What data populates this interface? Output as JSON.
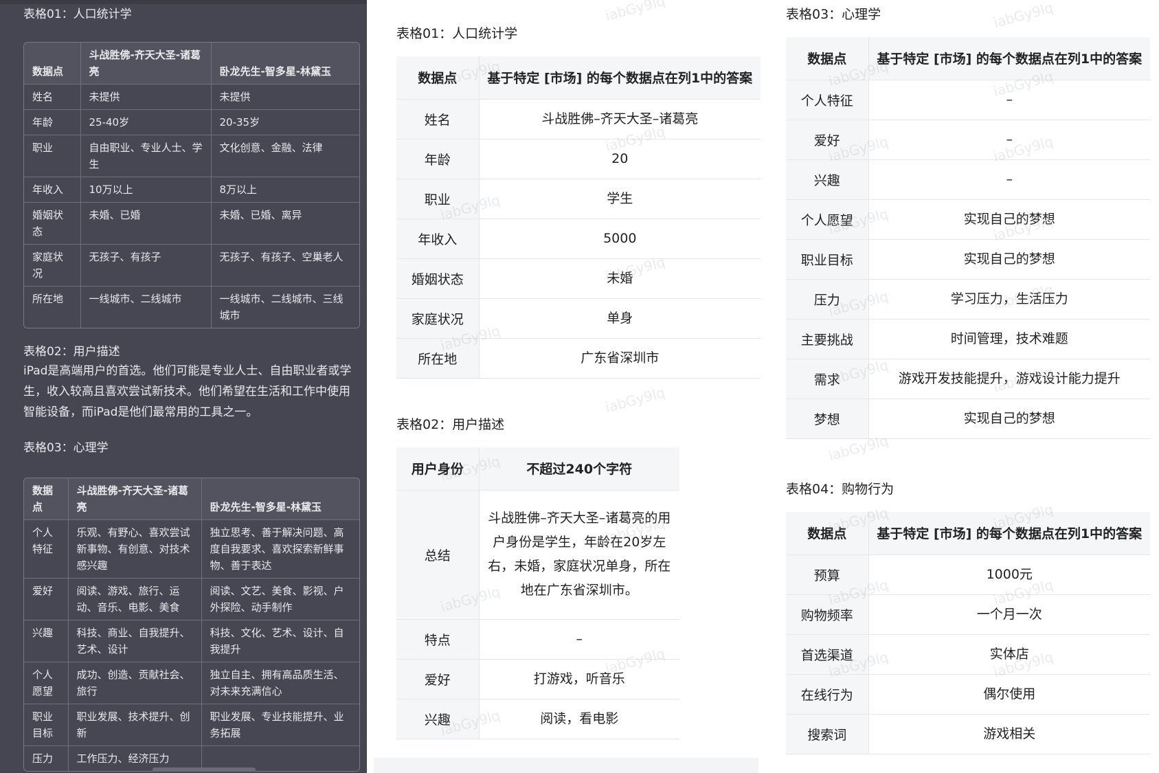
{
  "left": {
    "t01_title": "表格01：人口统计学",
    "t01_headers": [
      "数据点",
      "斗战胜佛-齐天大圣-诸葛亮",
      "卧龙先生-智多星-林黛玉"
    ],
    "t01_rows": [
      [
        "姓名",
        "未提供",
        "未提供"
      ],
      [
        "年龄",
        "25-40岁",
        "20-35岁"
      ],
      [
        "职业",
        "自由职业、专业人士、学生",
        "文化创意、金融、法律"
      ],
      [
        "年收入",
        "10万以上",
        "8万以上"
      ],
      [
        "婚姻状态",
        "未婚、已婚",
        "未婚、已婚、离异"
      ],
      [
        "家庭状况",
        "无孩子、有孩子",
        "无孩子、有孩子、空巢老人"
      ],
      [
        "所在地",
        "一线城市、二线城市",
        "一线城市、二线城市、三线城市"
      ]
    ],
    "t02_title": "表格02：用户描述",
    "t02_text": "iPad是高端用户的首选。他们可能是专业人士、自由职业者或学生，收入较高且喜欢尝试新技术。他们希望在生活和工作中使用智能设备，而iPad是他们最常用的工具之一。",
    "t03_title": "表格03：心理学",
    "t03_headers": [
      "数据点",
      "斗战胜佛-齐天大圣-诸葛亮",
      "卧龙先生-智多星-林黛玉"
    ],
    "t03_rows": [
      [
        "个人特征",
        "乐观、有野心、喜欢尝试新事物、有创意、对技术感兴趣",
        "独立思考、善于解决问题、高度自我要求、喜欢探索新鲜事物、善于表达"
      ],
      [
        "爱好",
        "阅读、游戏、旅行、运动、音乐、电影、美食",
        "阅读、文艺、美食、影视、户外探险、动手制作"
      ],
      [
        "兴趣",
        "科技、商业、自我提升、艺术、设计",
        "科技、文化、艺术、设计、自我提升"
      ],
      [
        "个人愿望",
        "成功、创造、贡献社会、旅行",
        "独立自主、拥有高品质生活、对未来充满信心"
      ],
      [
        "职业目标",
        "职业发展、技术提升、创新",
        "职业发展、专业技能提升、业务拓展"
      ],
      [
        "压力",
        "工作压力、经济压力",
        ""
      ]
    ]
  },
  "mid": {
    "t01_title": "表格01：人口统计学",
    "t01_headers": [
      "数据点",
      "基于特定 [市场] 的每个数据点在列1中的答案"
    ],
    "t01_rows": [
      [
        "姓名",
        "斗战胜佛–齐天大圣–诸葛亮"
      ],
      [
        "年龄",
        "20"
      ],
      [
        "职业",
        "学生"
      ],
      [
        "年收入",
        "5000"
      ],
      [
        "婚姻状态",
        "未婚"
      ],
      [
        "家庭状况",
        "单身"
      ],
      [
        "所在地",
        "广东省深圳市"
      ]
    ],
    "t02_title": "表格02：用户描述",
    "t02_headers": [
      "用户身份",
      "不超过240个字符"
    ],
    "t02_rows": [
      [
        "总结",
        "斗战胜佛–齐天大圣–诸葛亮的用户身份是学生，年龄在20岁左右，未婚，家庭状况单身，所在地在广东省深圳市。"
      ],
      [
        "特点",
        "–"
      ],
      [
        "爱好",
        "打游戏，听音乐"
      ],
      [
        "兴趣",
        "阅读，看电影"
      ]
    ]
  },
  "right": {
    "t03_title": "表格03：心理学",
    "t03_headers": [
      "数据点",
      "基于特定 [市场] 的每个数据点在列1中的答案"
    ],
    "t03_rows": [
      [
        "个人特征",
        "–"
      ],
      [
        "爱好",
        "–"
      ],
      [
        "兴趣",
        "–"
      ],
      [
        "个人愿望",
        "实现自己的梦想"
      ],
      [
        "职业目标",
        "实现自己的梦想"
      ],
      [
        "压力",
        "学习压力，生活压力"
      ],
      [
        "主要挑战",
        "时间管理，技术难题"
      ],
      [
        "需求",
        "游戏开发技能提升，游戏设计能力提升"
      ],
      [
        "梦想",
        "实现自己的梦想"
      ]
    ],
    "t04_title": "表格04：购物行为",
    "t04_headers": [
      "数据点",
      "基于特定 [市场] 的每个数据点在列1中的答案"
    ],
    "t04_rows": [
      [
        "预算",
        "1000元"
      ],
      [
        "购物频率",
        "一个月一次"
      ],
      [
        "首选渠道",
        "实体店"
      ],
      [
        "在线行为",
        "偶尔使用"
      ],
      [
        "搜索词",
        "游戏相关"
      ]
    ]
  },
  "watermark": "iabGy9lq"
}
